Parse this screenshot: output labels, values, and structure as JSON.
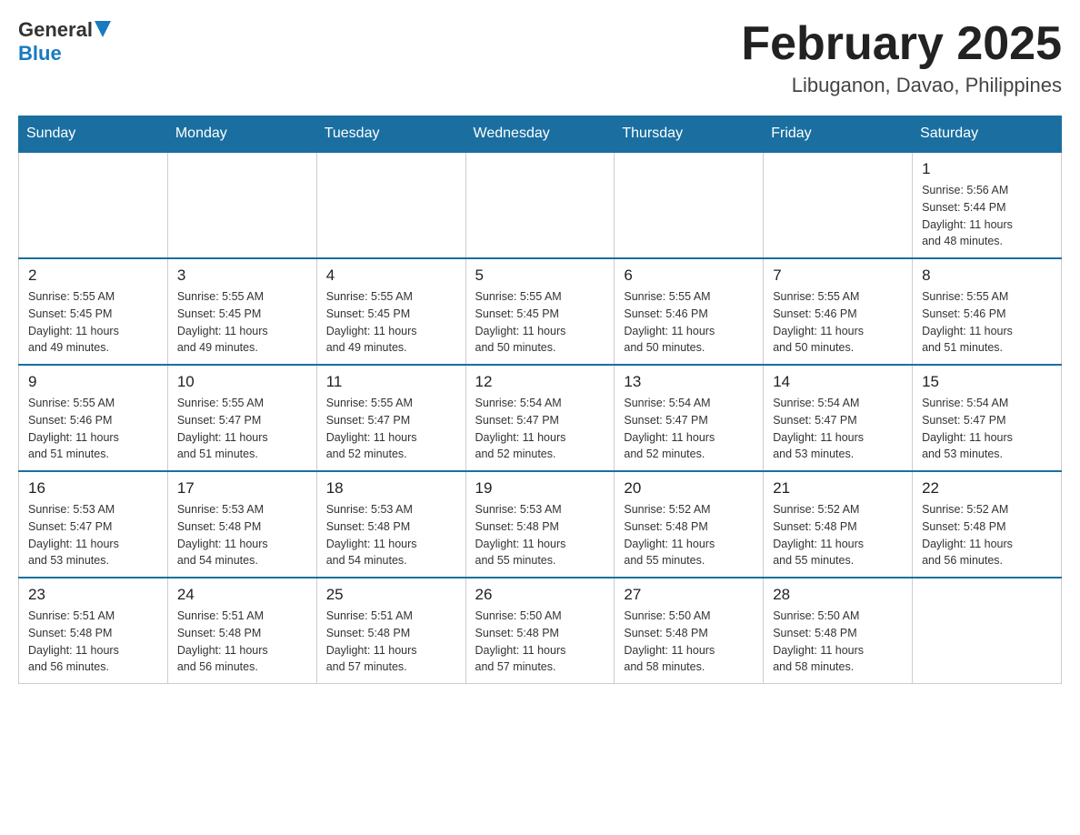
{
  "header": {
    "logo_general": "General",
    "logo_blue": "Blue",
    "month_title": "February 2025",
    "location": "Libuganon, Davao, Philippines"
  },
  "weekdays": [
    "Sunday",
    "Monday",
    "Tuesday",
    "Wednesday",
    "Thursday",
    "Friday",
    "Saturday"
  ],
  "weeks": [
    [
      {
        "day": "",
        "info": ""
      },
      {
        "day": "",
        "info": ""
      },
      {
        "day": "",
        "info": ""
      },
      {
        "day": "",
        "info": ""
      },
      {
        "day": "",
        "info": ""
      },
      {
        "day": "",
        "info": ""
      },
      {
        "day": "1",
        "info": "Sunrise: 5:56 AM\nSunset: 5:44 PM\nDaylight: 11 hours\nand 48 minutes."
      }
    ],
    [
      {
        "day": "2",
        "info": "Sunrise: 5:55 AM\nSunset: 5:45 PM\nDaylight: 11 hours\nand 49 minutes."
      },
      {
        "day": "3",
        "info": "Sunrise: 5:55 AM\nSunset: 5:45 PM\nDaylight: 11 hours\nand 49 minutes."
      },
      {
        "day": "4",
        "info": "Sunrise: 5:55 AM\nSunset: 5:45 PM\nDaylight: 11 hours\nand 49 minutes."
      },
      {
        "day": "5",
        "info": "Sunrise: 5:55 AM\nSunset: 5:45 PM\nDaylight: 11 hours\nand 50 minutes."
      },
      {
        "day": "6",
        "info": "Sunrise: 5:55 AM\nSunset: 5:46 PM\nDaylight: 11 hours\nand 50 minutes."
      },
      {
        "day": "7",
        "info": "Sunrise: 5:55 AM\nSunset: 5:46 PM\nDaylight: 11 hours\nand 50 minutes."
      },
      {
        "day": "8",
        "info": "Sunrise: 5:55 AM\nSunset: 5:46 PM\nDaylight: 11 hours\nand 51 minutes."
      }
    ],
    [
      {
        "day": "9",
        "info": "Sunrise: 5:55 AM\nSunset: 5:46 PM\nDaylight: 11 hours\nand 51 minutes."
      },
      {
        "day": "10",
        "info": "Sunrise: 5:55 AM\nSunset: 5:47 PM\nDaylight: 11 hours\nand 51 minutes."
      },
      {
        "day": "11",
        "info": "Sunrise: 5:55 AM\nSunset: 5:47 PM\nDaylight: 11 hours\nand 52 minutes."
      },
      {
        "day": "12",
        "info": "Sunrise: 5:54 AM\nSunset: 5:47 PM\nDaylight: 11 hours\nand 52 minutes."
      },
      {
        "day": "13",
        "info": "Sunrise: 5:54 AM\nSunset: 5:47 PM\nDaylight: 11 hours\nand 52 minutes."
      },
      {
        "day": "14",
        "info": "Sunrise: 5:54 AM\nSunset: 5:47 PM\nDaylight: 11 hours\nand 53 minutes."
      },
      {
        "day": "15",
        "info": "Sunrise: 5:54 AM\nSunset: 5:47 PM\nDaylight: 11 hours\nand 53 minutes."
      }
    ],
    [
      {
        "day": "16",
        "info": "Sunrise: 5:53 AM\nSunset: 5:47 PM\nDaylight: 11 hours\nand 53 minutes."
      },
      {
        "day": "17",
        "info": "Sunrise: 5:53 AM\nSunset: 5:48 PM\nDaylight: 11 hours\nand 54 minutes."
      },
      {
        "day": "18",
        "info": "Sunrise: 5:53 AM\nSunset: 5:48 PM\nDaylight: 11 hours\nand 54 minutes."
      },
      {
        "day": "19",
        "info": "Sunrise: 5:53 AM\nSunset: 5:48 PM\nDaylight: 11 hours\nand 55 minutes."
      },
      {
        "day": "20",
        "info": "Sunrise: 5:52 AM\nSunset: 5:48 PM\nDaylight: 11 hours\nand 55 minutes."
      },
      {
        "day": "21",
        "info": "Sunrise: 5:52 AM\nSunset: 5:48 PM\nDaylight: 11 hours\nand 55 minutes."
      },
      {
        "day": "22",
        "info": "Sunrise: 5:52 AM\nSunset: 5:48 PM\nDaylight: 11 hours\nand 56 minutes."
      }
    ],
    [
      {
        "day": "23",
        "info": "Sunrise: 5:51 AM\nSunset: 5:48 PM\nDaylight: 11 hours\nand 56 minutes."
      },
      {
        "day": "24",
        "info": "Sunrise: 5:51 AM\nSunset: 5:48 PM\nDaylight: 11 hours\nand 56 minutes."
      },
      {
        "day": "25",
        "info": "Sunrise: 5:51 AM\nSunset: 5:48 PM\nDaylight: 11 hours\nand 57 minutes."
      },
      {
        "day": "26",
        "info": "Sunrise: 5:50 AM\nSunset: 5:48 PM\nDaylight: 11 hours\nand 57 minutes."
      },
      {
        "day": "27",
        "info": "Sunrise: 5:50 AM\nSunset: 5:48 PM\nDaylight: 11 hours\nand 58 minutes."
      },
      {
        "day": "28",
        "info": "Sunrise: 5:50 AM\nSunset: 5:48 PM\nDaylight: 11 hours\nand 58 minutes."
      },
      {
        "day": "",
        "info": ""
      }
    ]
  ]
}
